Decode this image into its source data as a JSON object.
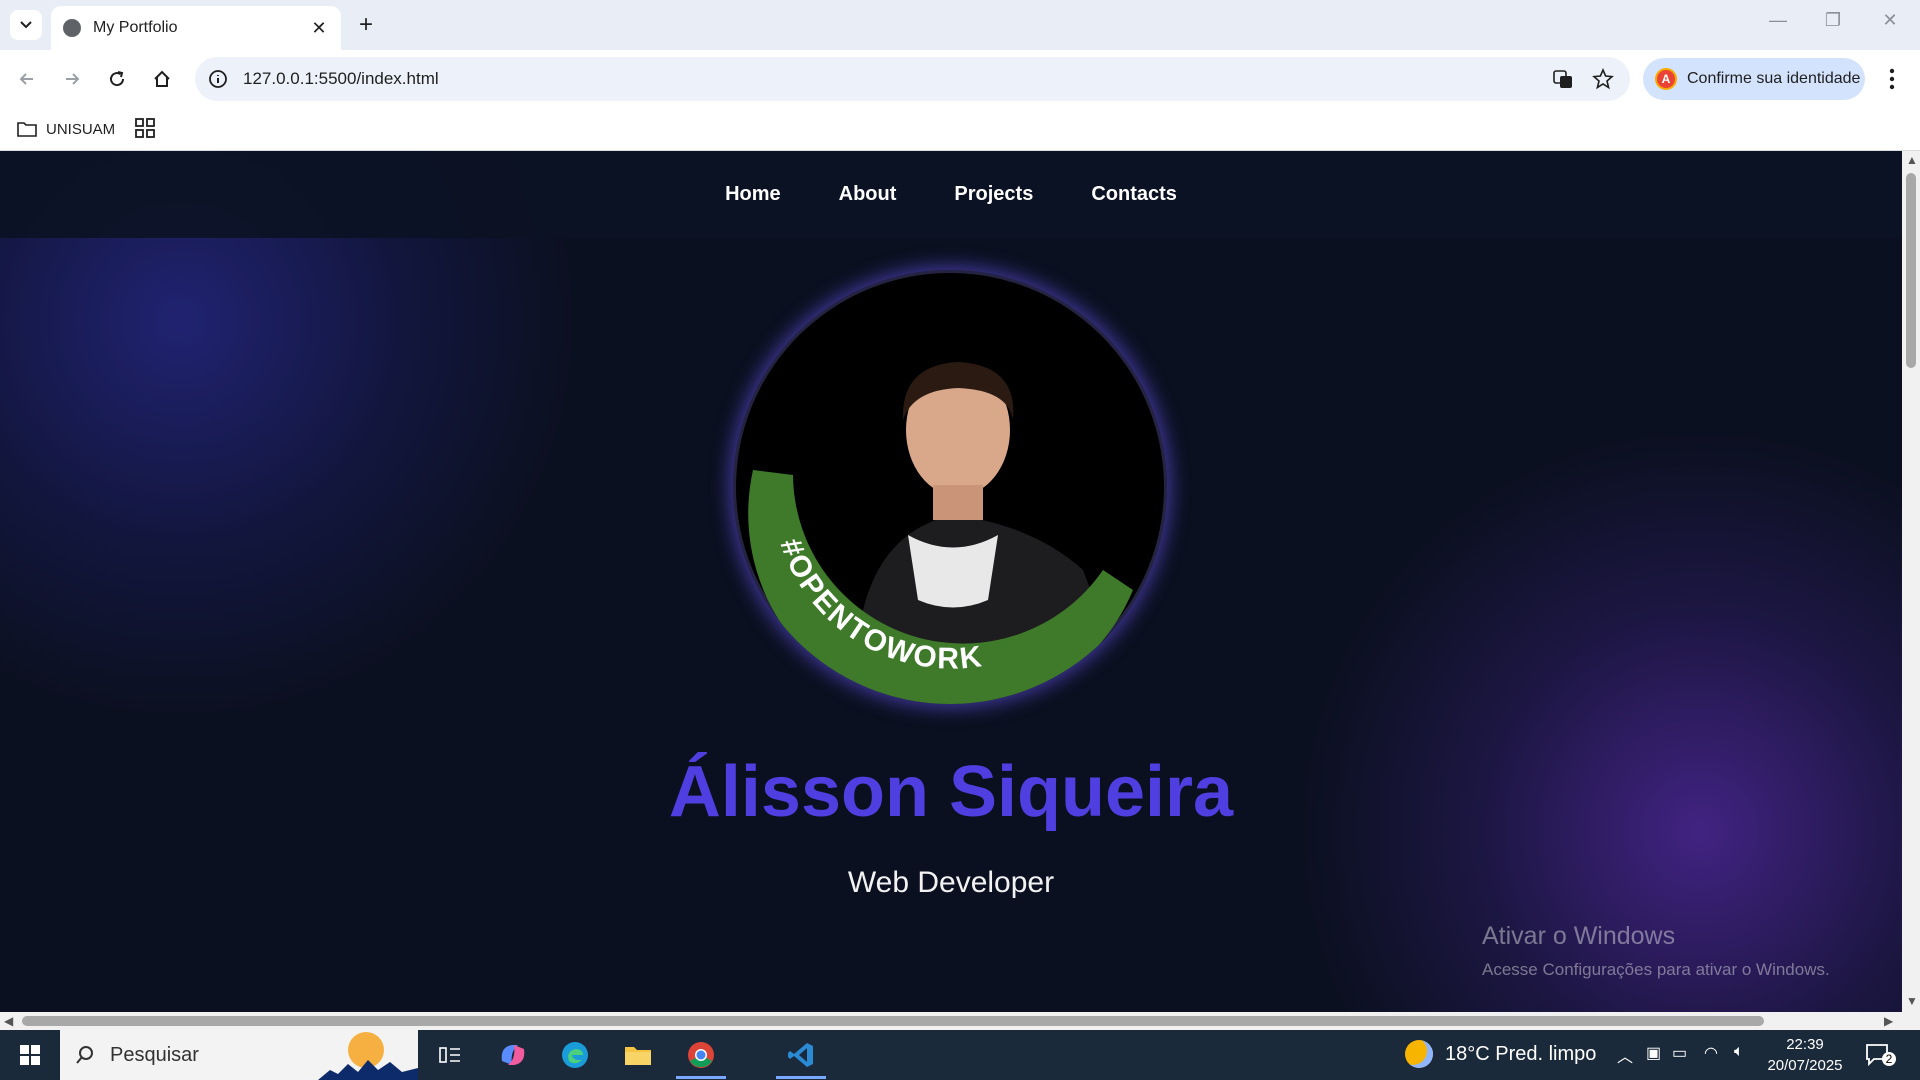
{
  "browser": {
    "tab_title": "My Portfolio",
    "url": "127.0.0.1:5500/index.html",
    "profile_chip_label": "Confirme sua identidade",
    "profile_initial": "A",
    "bookmark_folder": "UNISUAM"
  },
  "site": {
    "nav": [
      "Home",
      "About",
      "Projects",
      "Contacts"
    ],
    "name": "Álisson Siqueira",
    "role": "Web Developer",
    "badge_text": "#OPENTOWORK"
  },
  "windows_watermark": {
    "title": "Ativar o Windows",
    "subtitle": "Acesse Configurações para ativar o Windows."
  },
  "taskbar": {
    "search_placeholder": "Pesquisar",
    "weather": "18°C  Pred. limpo",
    "time": "22:39",
    "date": "20/07/2025",
    "notification_count": "2"
  },
  "colors": {
    "accent_name": "#4f3fe0",
    "page_bg": "#0b1020",
    "opentowork_green": "#3e7a2a"
  }
}
